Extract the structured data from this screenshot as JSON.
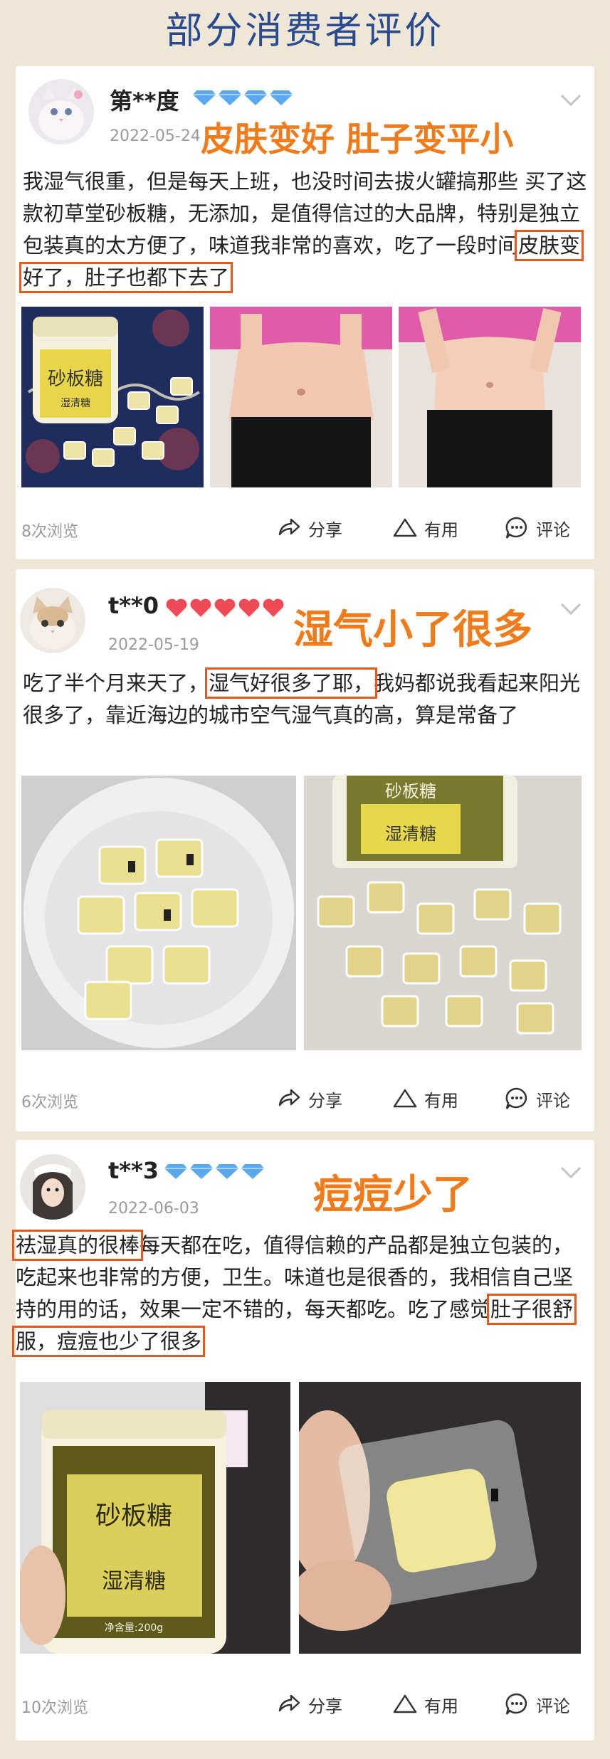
{
  "page": {
    "title": "部分消费者评价"
  },
  "reviews": [
    {
      "username": "第**度",
      "badge_type": "diamond",
      "badge_count": 4,
      "date": "2022-05-24",
      "highlight": "皮肤变好  肚子变平小",
      "text_before": "我湿气很重，但是每天上班，也没时间去拔火罐搞那些 买了这款初草堂砂板糖，无添加，是值得信过的大品牌，特别是独立包装真的太方便了，味道我非常的喜欢，吃了一段时间",
      "text_marked": "皮肤变好了，肚子也都下去了",
      "text_after": "",
      "views": "8次浏览"
    },
    {
      "username": "t**0",
      "badge_type": "heart",
      "badge_count": 5,
      "date": "2022-05-19",
      "highlight": "湿气小了很多",
      "text_before": "吃了半个月来天了，",
      "text_marked": "湿气好很多了耶，",
      "text_after": "我妈都说我看起来阳光很多了，靠近海边的城市空气湿气真的高，算是常备了",
      "views": "6次浏览"
    },
    {
      "username": "t**3",
      "badge_type": "diamond",
      "badge_count": 4,
      "date": "2022-06-03",
      "highlight": "痘痘少了",
      "text_marked_1": "祛湿真的很棒",
      "text_middle": "每天都在吃，值得信赖的产品都是独立包装的，吃起来也非常的方便，卫生。味道也是很香的，我相信自己坚持的用的话，效果一定不错的，每天都吃。吃了感觉",
      "text_marked_2": "肚子很舒服，痘痘也少了很多",
      "views": "10次浏览"
    }
  ],
  "product": {
    "label_main": "砂板糖",
    "label_sub": "湿清糖",
    "label_net": "净含量:200g"
  },
  "actions": {
    "share": "分享",
    "useful": "有用",
    "comment": "评论"
  },
  "colors": {
    "title": "#2a4a8f",
    "highlight": "#f07b1c",
    "mark_border": "#e25a22",
    "background": "#eee6d6",
    "diamond": "#5aa9f0",
    "heart": "#ef4b57"
  },
  "icons": [
    "share-icon",
    "triangle-useful-icon",
    "comment-bubble-icon",
    "chevron-down-icon",
    "diamond-icon",
    "heart-icon"
  ]
}
